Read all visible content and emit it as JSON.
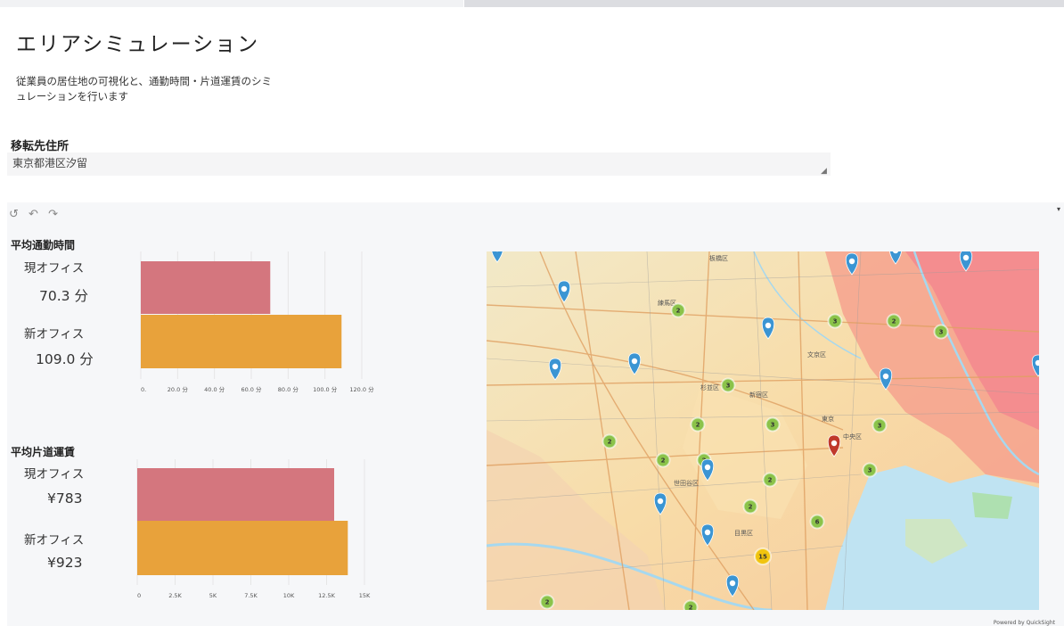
{
  "page": {
    "title": "エリアシミュレーション",
    "description": "従業員の居住地の可視化と、通勤時間・片道運賃のシミュレーションを行います"
  },
  "form": {
    "label": "移転先住所",
    "value": "東京都港区汐留"
  },
  "toolbar": {
    "reset_icon": "reset-icon",
    "undo_icon": "undo-icon",
    "redo_icon": "redo-icon"
  },
  "commute": {
    "title": "平均通勤時間",
    "current_label": "現オフィス",
    "current_value": "70.3 分",
    "new_label": "新オフィス",
    "new_value": "109.0 分"
  },
  "fare": {
    "title": "平均片道運賃",
    "current_label": "現オフィス",
    "current_value": "¥783",
    "new_label": "新オフィス",
    "new_value": "¥923"
  },
  "chart_data": [
    {
      "type": "bar",
      "orientation": "horizontal",
      "title": "平均通勤時間",
      "categories": [
        "現オフィス",
        "新オフィス"
      ],
      "values": [
        70.3,
        109.0
      ],
      "colors": [
        "#d4767e",
        "#e8a23b"
      ],
      "xlim": [
        0,
        120
      ],
      "tick_labels": [
        "0.",
        "20.0 分",
        "40.0 分",
        "60.0 分",
        "80.0 分",
        "100.0 分",
        "120.0 分"
      ]
    },
    {
      "type": "bar",
      "orientation": "horizontal",
      "title": "平均片道運賃",
      "categories": [
        "現オフィス",
        "新オフィス"
      ],
      "values": [
        13000,
        13900
      ],
      "colors": [
        "#d4767e",
        "#e8a23b"
      ],
      "xlim": [
        0,
        15000
      ],
      "tick_labels": [
        "0",
        "2.5K",
        "5K",
        "7.5K",
        "10K",
        "12.5K",
        "15K"
      ]
    }
  ],
  "map": {
    "place_labels": [
      "練馬区",
      "杉並区",
      "新宿区",
      "文京区",
      "東京",
      "中央区",
      "目黒区",
      "世田谷区",
      "板橋区"
    ],
    "clusters": [
      "2",
      "3",
      "2",
      "3",
      "2",
      "3",
      "2",
      "2",
      "2",
      "2",
      "3",
      "3",
      "3",
      "6",
      "15",
      "2",
      "2",
      "2"
    ],
    "colors": {
      "marker_blue": "#3b95d3",
      "marker_red": "#c0392b",
      "cluster_green": "#8bc34a",
      "cluster_yellow": "#f1c40f",
      "heat_pink": "#f48a8f",
      "water": "#bfe3f2"
    },
    "powered_by": "Powered by QuickSight"
  }
}
